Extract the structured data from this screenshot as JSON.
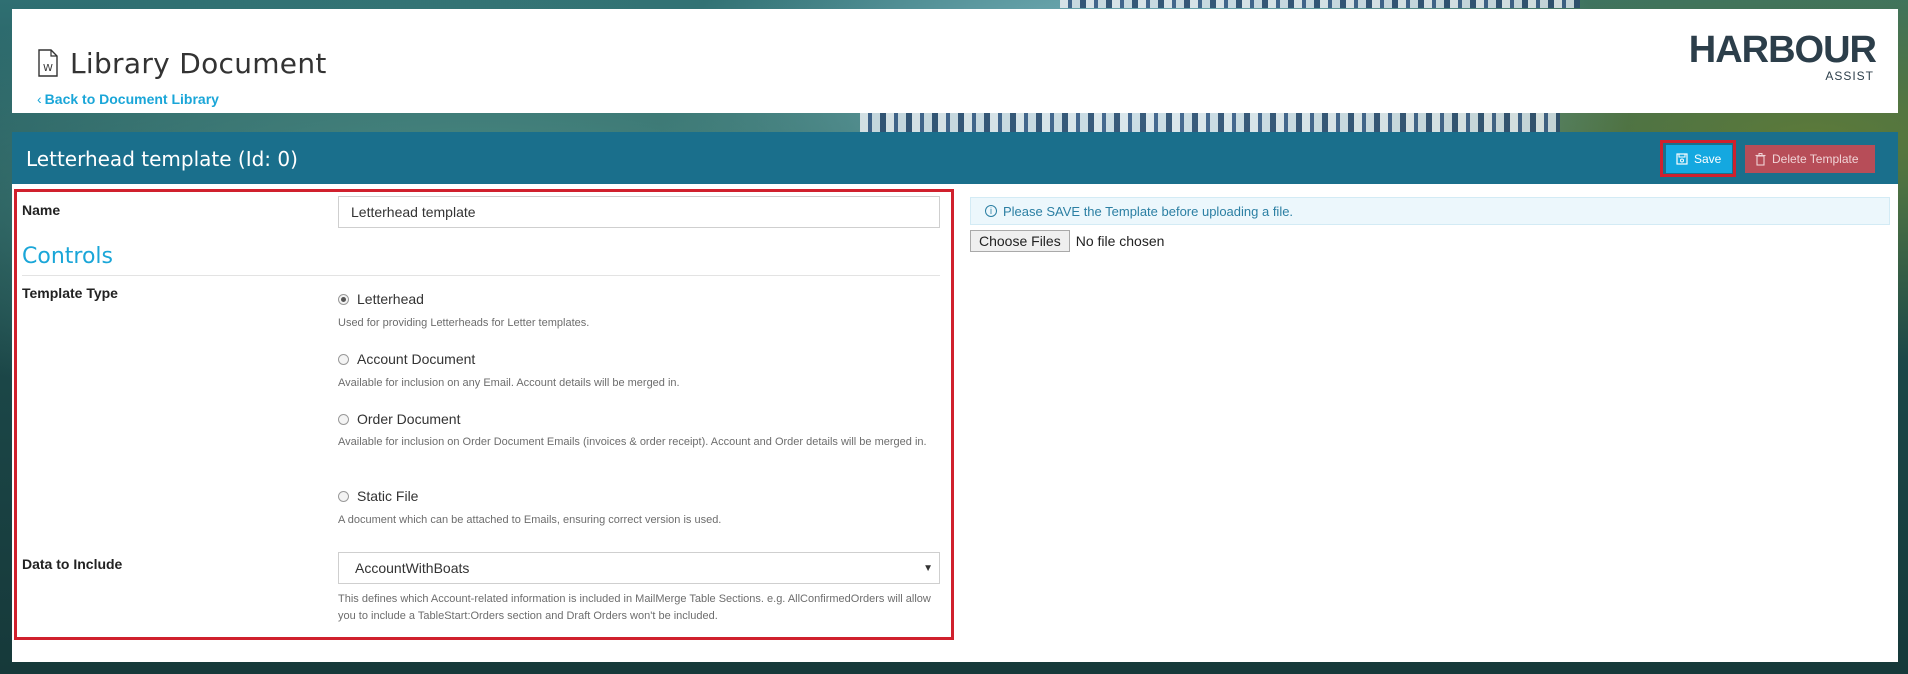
{
  "header": {
    "title": "Library Document",
    "back_link": "Back to Document Library",
    "logo_word": "HARBOUR",
    "logo_sub": "ASSIST"
  },
  "panel": {
    "title": "Letterhead template (Id: 0)",
    "save_label": "Save",
    "delete_label": "Delete Template"
  },
  "form": {
    "name_label": "Name",
    "name_value": "Letterhead template",
    "section_title": "Controls",
    "template_type_label": "Template Type",
    "options": [
      {
        "label": "Letterhead",
        "help": "Used for providing Letterheads for Letter templates.",
        "checked": true
      },
      {
        "label": "Account Document",
        "help": "Available for inclusion on any Email. Account details will be merged in.",
        "checked": false
      },
      {
        "label": "Order Document",
        "help": "Available for inclusion on Order Document Emails (invoices & order receipt). Account and Order details will be merged in.",
        "checked": false
      },
      {
        "label": "Static File",
        "help": "A document which can be attached to Emails, ensuring correct version is used.",
        "checked": false
      }
    ],
    "data_label": "Data to Include",
    "data_value": "AccountWithBoats",
    "data_help": "This defines which Account-related information is included in MailMerge Table Sections. e.g. AllConfirmedOrders will allow you to include a TableStart:Orders section and Draft Orders won't be included."
  },
  "upload": {
    "alert": "Please SAVE the Template before uploading a file.",
    "choose_files": "Choose Files",
    "no_file": "No file chosen"
  },
  "colors": {
    "accent": "#1aa6d8",
    "panel_header": "#1a6f8c",
    "delete": "#b74d58",
    "highlight": "#d0202d"
  }
}
